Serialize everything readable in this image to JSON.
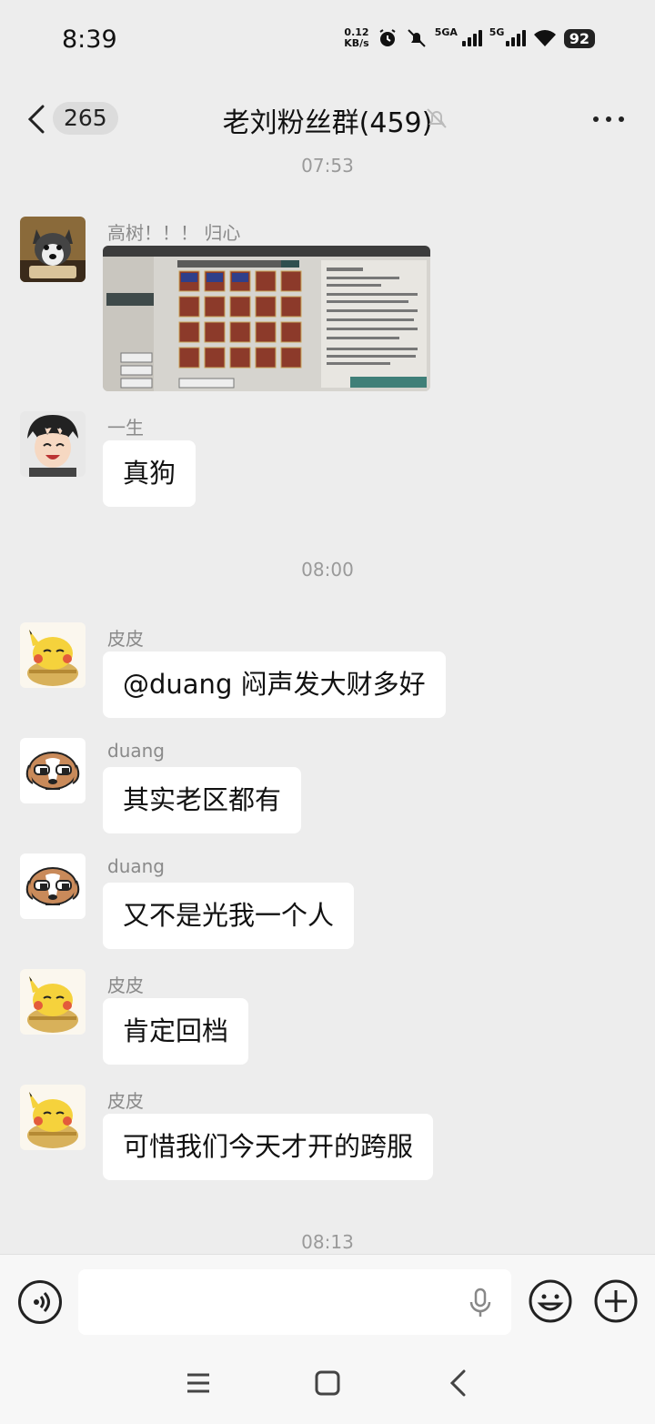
{
  "status": {
    "time": "8:39",
    "net_speed_value": "0.12",
    "net_speed_unit": "KB/s",
    "sim1": "5GA",
    "sim2": "5G",
    "battery": "92"
  },
  "header": {
    "unread_count": "265",
    "title": "老刘粉丝群(459)"
  },
  "messages": [
    {
      "type": "time",
      "text": "07:53"
    },
    {
      "type": "image",
      "sender": "高树！！！ 归心",
      "avatar": "husky-avatar"
    },
    {
      "type": "text",
      "sender": "一生",
      "text": "真狗",
      "avatar": "anime-boy-avatar"
    },
    {
      "type": "time",
      "text": "08:00"
    },
    {
      "type": "text",
      "sender": "皮皮",
      "text": "@duang 闷声发大财多好",
      "avatar": "pikachu-avatar"
    },
    {
      "type": "text",
      "sender": "duang",
      "text": "其实老区都有",
      "avatar": "dog-avatar"
    },
    {
      "type": "text",
      "sender": "duang",
      "text": "又不是光我一个人",
      "avatar": "dog-avatar"
    },
    {
      "type": "text",
      "sender": "皮皮",
      "text": "肯定回档",
      "avatar": "pikachu-avatar"
    },
    {
      "type": "text",
      "sender": "皮皮",
      "text": "可惜我们今天才开的跨服",
      "avatar": "pikachu-avatar"
    },
    {
      "type": "time",
      "text": "08:13"
    }
  ],
  "input": {
    "value": "",
    "placeholder": ""
  },
  "icons": {
    "voice": "voice-icon",
    "mic": "mic-icon",
    "emoji": "emoji-icon",
    "plus": "plus-icon",
    "mute": "mute-bell-icon",
    "more": "more-icon"
  },
  "colors": {
    "background": "#ededed",
    "bubble": "#ffffff",
    "timestamp": "#9a9a9a"
  }
}
